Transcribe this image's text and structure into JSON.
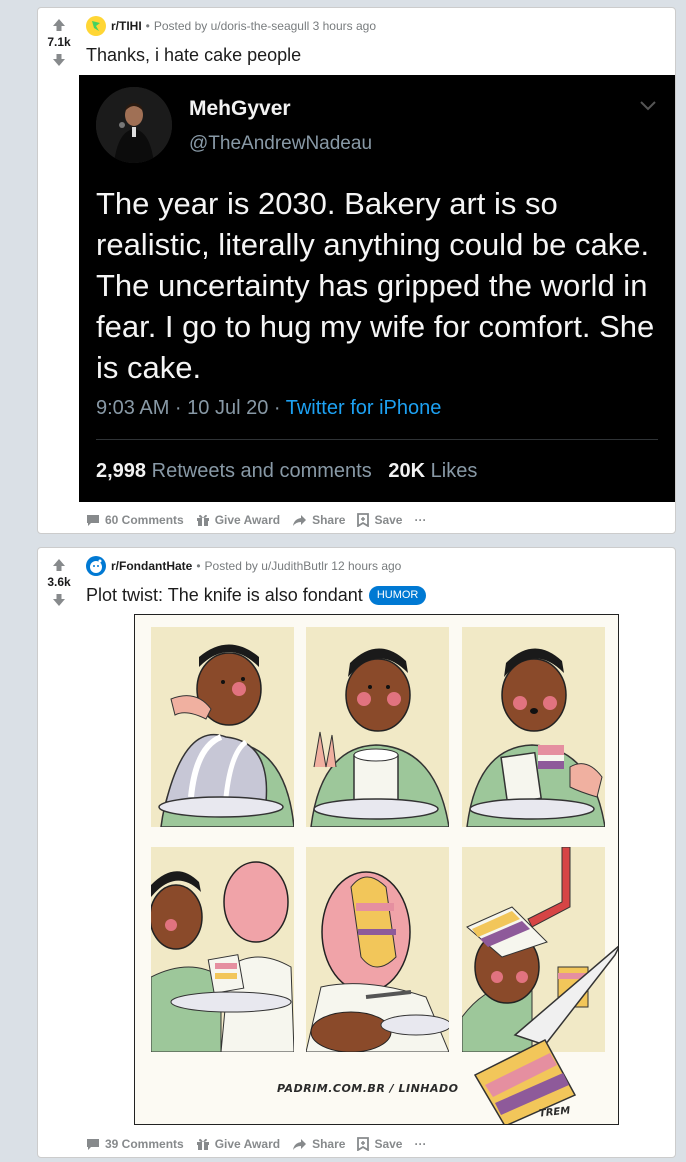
{
  "posts": [
    {
      "votes": "7.1k",
      "subreddit": "r/TIHI",
      "posted_by": "Posted by u/doris-the-seagull 3 hours ago",
      "title": "Thanks, i hate cake people",
      "tweet": {
        "name": "MehGyver",
        "handle": "@TheAndrewNadeau",
        "body": "The year is 2030. Bakery art is so realistic, literally anything could be cake. The uncertainty has gripped the world in fear. I go to hug my wife for comfort. She is cake.",
        "time": "9:03 AM · 10 Jul 20 · ",
        "source": "Twitter for iPhone",
        "retweets_count": "2,998",
        "retweets_label": "Retweets and comments",
        "likes_count": "20K",
        "likes_label": "Likes"
      },
      "actions": {
        "comments": "60 Comments",
        "award": "Give Award",
        "share": "Share",
        "save": "Save",
        "more": "···"
      }
    },
    {
      "votes": "3.6k",
      "subreddit": "r/FondantHate",
      "posted_by": "Posted by u/JudithButlr 12 hours ago",
      "title": "Plot twist: The knife is also fondant",
      "flair": "HUMOR",
      "comic": {
        "credit": "PADRIM.COM.BR / LINHADO",
        "credit2": "TREM"
      },
      "actions": {
        "comments": "39 Comments",
        "award": "Give Award",
        "share": "Share",
        "save": "Save",
        "more": "···"
      }
    }
  ],
  "colors": {
    "background": "#dae0e6",
    "flair": "#0079d3",
    "tweet_link": "#1da1f2",
    "meta_text": "#787c7e"
  },
  "icons": [
    "upvote-icon",
    "downvote-icon",
    "comment-icon",
    "gift-icon",
    "share-icon",
    "save-icon",
    "more-icon",
    "chevron-down-icon"
  ]
}
